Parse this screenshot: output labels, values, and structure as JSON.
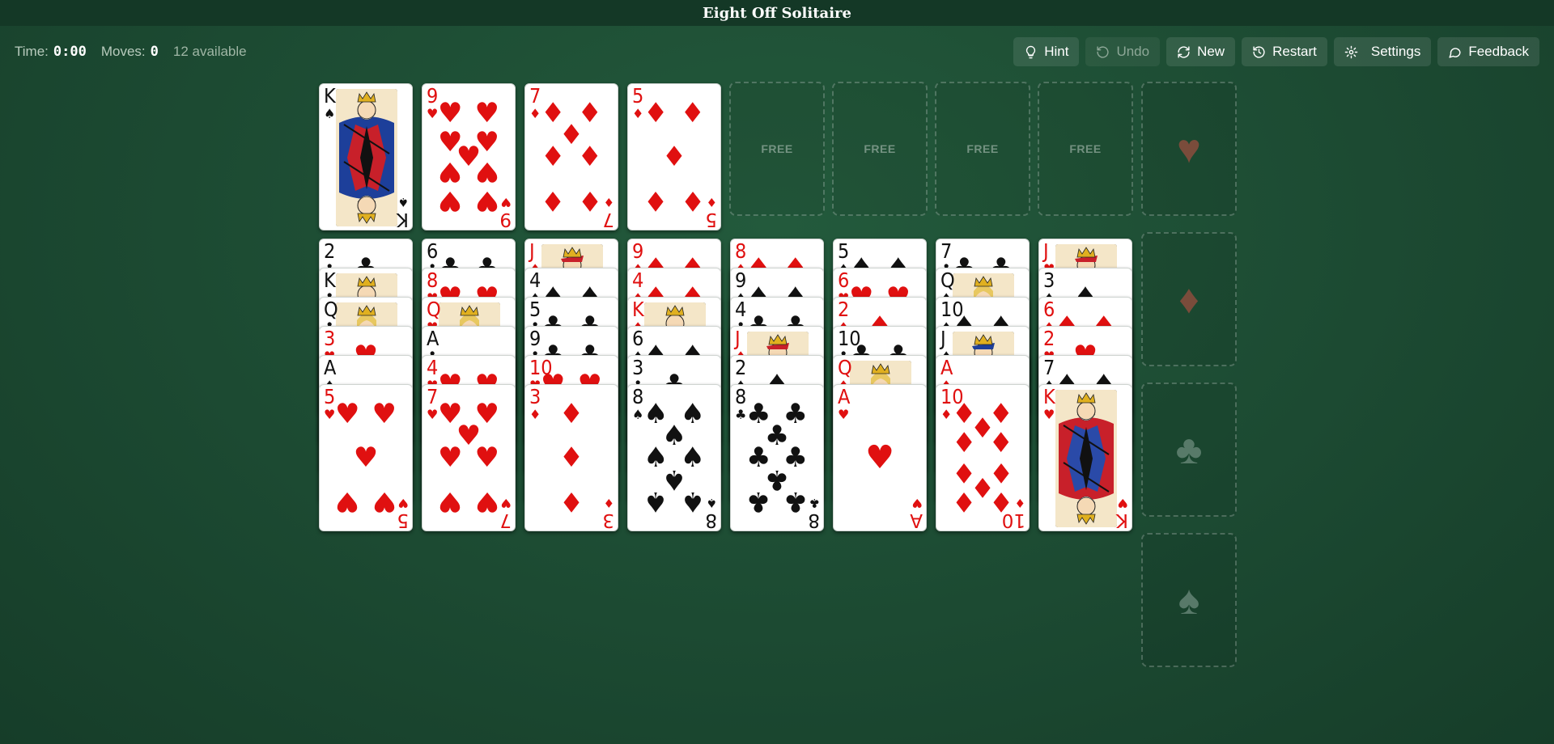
{
  "title": "Eight Off Solitaire",
  "status": {
    "time_label": "Time:",
    "time_value": "0:00",
    "moves_label": "Moves:",
    "moves_value": "0",
    "available": "12 available"
  },
  "toolbar": {
    "hint": "Hint",
    "undo": "Undo",
    "new": "New",
    "restart": "Restart",
    "settings": "Settings",
    "feedback": "Feedback"
  },
  "colors": {
    "red_suit": "#e01010",
    "black_suit": "#111111",
    "table": "#1c4a32"
  },
  "reserve": [
    {
      "rank": "K",
      "suit": "spades"
    },
    {
      "rank": "9",
      "suit": "hearts"
    },
    {
      "rank": "7",
      "suit": "diamonds"
    },
    {
      "rank": "5",
      "suit": "diamonds"
    },
    null,
    null,
    null,
    null
  ],
  "free_label": "FREE",
  "foundations": [
    {
      "suit": "hearts",
      "icon": "heart-icon"
    },
    {
      "suit": "diamonds",
      "icon": "diamond-icon"
    },
    {
      "suit": "clubs",
      "icon": "club-icon"
    },
    {
      "suit": "spades",
      "icon": "spade-icon"
    }
  ],
  "tableau": [
    [
      {
        "rank": "2",
        "suit": "clubs"
      },
      {
        "rank": "K",
        "suit": "clubs"
      },
      {
        "rank": "Q",
        "suit": "clubs"
      },
      {
        "rank": "3",
        "suit": "hearts"
      },
      {
        "rank": "A",
        "suit": "spades"
      },
      {
        "rank": "5",
        "suit": "hearts"
      }
    ],
    [
      {
        "rank": "6",
        "suit": "clubs"
      },
      {
        "rank": "8",
        "suit": "hearts"
      },
      {
        "rank": "Q",
        "suit": "hearts"
      },
      {
        "rank": "A",
        "suit": "clubs"
      },
      {
        "rank": "4",
        "suit": "hearts"
      },
      {
        "rank": "7",
        "suit": "hearts"
      }
    ],
    [
      {
        "rank": "J",
        "suit": "diamonds"
      },
      {
        "rank": "4",
        "suit": "spades"
      },
      {
        "rank": "5",
        "suit": "clubs"
      },
      {
        "rank": "9",
        "suit": "clubs"
      },
      {
        "rank": "10",
        "suit": "hearts"
      },
      {
        "rank": "3",
        "suit": "diamonds"
      }
    ],
    [
      {
        "rank": "9",
        "suit": "diamonds"
      },
      {
        "rank": "4",
        "suit": "diamonds"
      },
      {
        "rank": "K",
        "suit": "diamonds"
      },
      {
        "rank": "6",
        "suit": "spades"
      },
      {
        "rank": "3",
        "suit": "clubs"
      },
      {
        "rank": "8",
        "suit": "spades"
      }
    ],
    [
      {
        "rank": "8",
        "suit": "diamonds"
      },
      {
        "rank": "9",
        "suit": "spades"
      },
      {
        "rank": "4",
        "suit": "clubs"
      },
      {
        "rank": "J",
        "suit": "diamonds"
      },
      {
        "rank": "2",
        "suit": "spades"
      },
      {
        "rank": "8",
        "suit": "clubs"
      }
    ],
    [
      {
        "rank": "5",
        "suit": "spades"
      },
      {
        "rank": "6",
        "suit": "hearts"
      },
      {
        "rank": "2",
        "suit": "diamonds"
      },
      {
        "rank": "10",
        "suit": "clubs"
      },
      {
        "rank": "Q",
        "suit": "diamonds"
      },
      {
        "rank": "A",
        "suit": "hearts"
      }
    ],
    [
      {
        "rank": "7",
        "suit": "clubs"
      },
      {
        "rank": "Q",
        "suit": "spades"
      },
      {
        "rank": "10",
        "suit": "spades"
      },
      {
        "rank": "J",
        "suit": "spades"
      },
      {
        "rank": "A",
        "suit": "diamonds"
      },
      {
        "rank": "10",
        "suit": "diamonds"
      }
    ],
    [
      {
        "rank": "J",
        "suit": "hearts"
      },
      {
        "rank": "3",
        "suit": "spades"
      },
      {
        "rank": "6",
        "suit": "diamonds"
      },
      {
        "rank": "2",
        "suit": "hearts"
      },
      {
        "rank": "7",
        "suit": "spades"
      },
      {
        "rank": "K",
        "suit": "hearts"
      }
    ]
  ]
}
